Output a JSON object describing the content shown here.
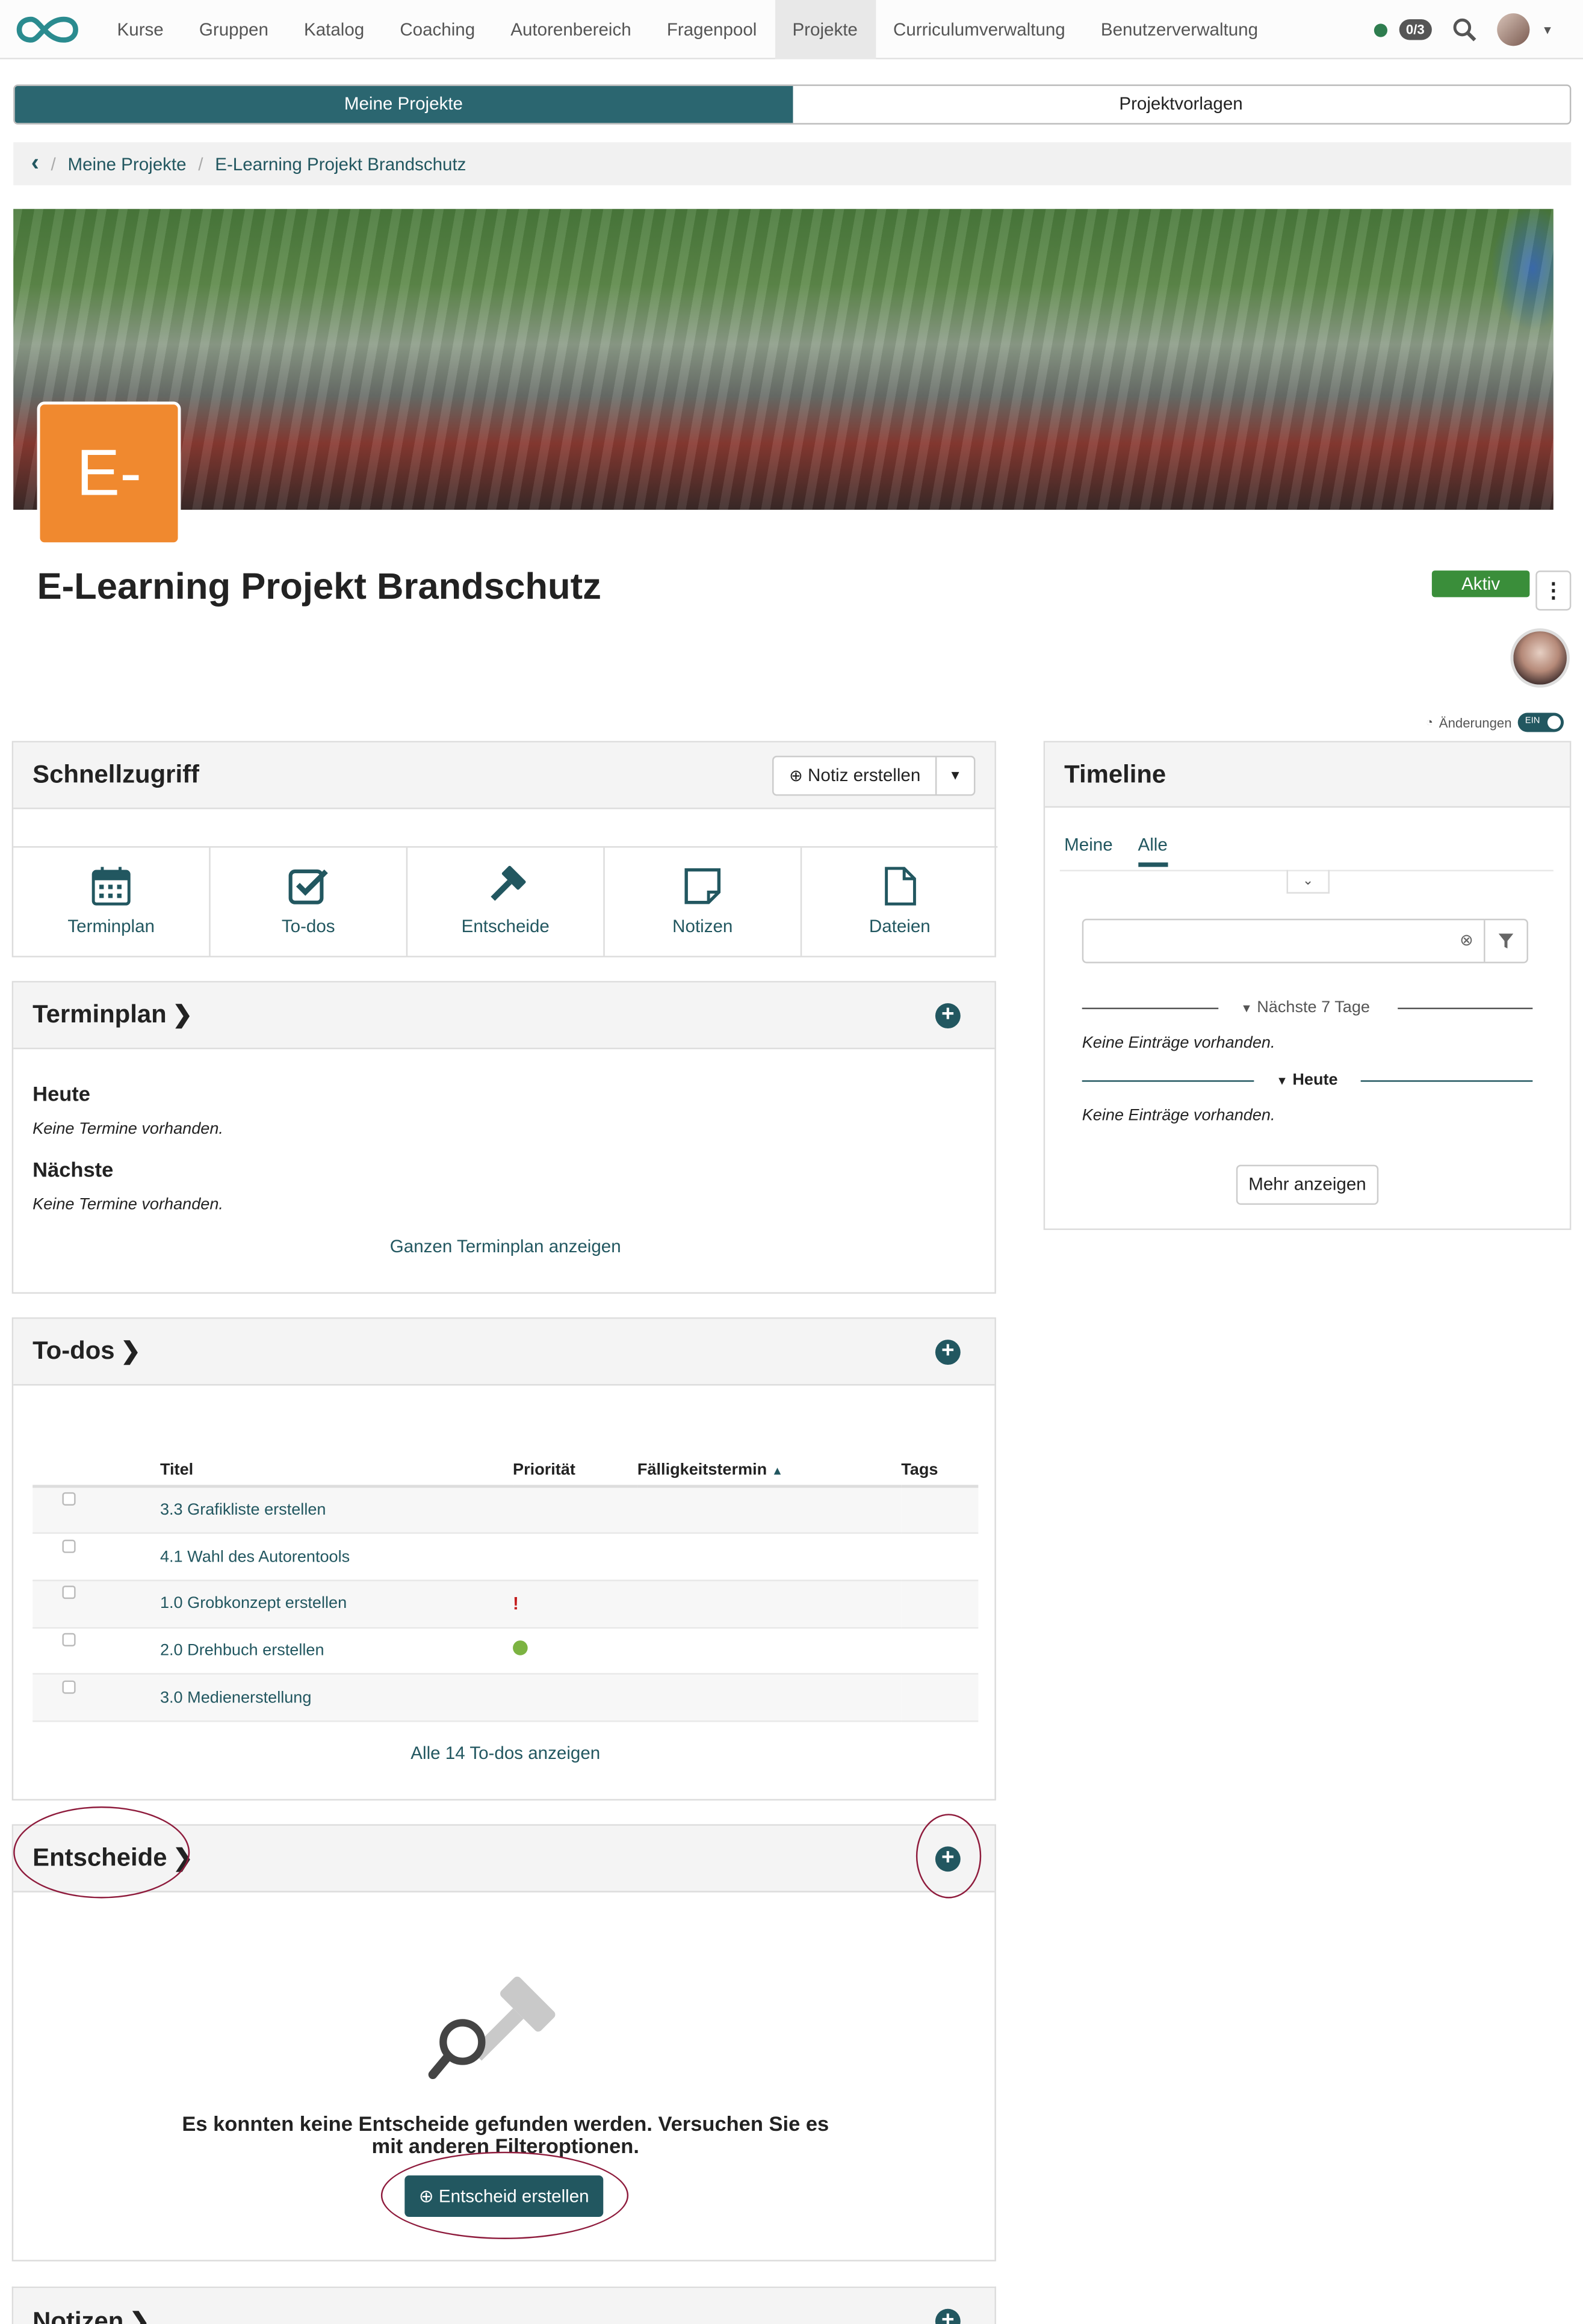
{
  "nav": {
    "items": [
      "Kurse",
      "Gruppen",
      "Katalog",
      "Coaching",
      "Autorenbereich",
      "Fragenpool",
      "Projekte",
      "Curriculumverwaltung",
      "Benutzerverwaltung"
    ],
    "active": "Projekte",
    "badge": "0/3"
  },
  "segments": {
    "mine": "Meine Projekte",
    "templates": "Projektvorlagen"
  },
  "breadcrumb": {
    "back": "‹",
    "sep": "/",
    "root": "Meine Projekte",
    "current": "E-Learning Projekt Brandschutz"
  },
  "project": {
    "logo_text": "E-",
    "title": "E-Learning Projekt Brandschutz",
    "status": "Aktiv",
    "changes_label": "Änderungen",
    "toggle_label": "EIN"
  },
  "quick": {
    "title": "Schnellzugriff",
    "create_note": "Notiz erstellen",
    "items": [
      "Terminplan",
      "To-dos",
      "Entscheide",
      "Notizen",
      "Dateien"
    ]
  },
  "terminplan": {
    "title": "Terminplan",
    "today": "Heute",
    "today_empty": "Keine Termine vorhanden.",
    "next": "Nächste",
    "next_empty": "Keine Termine vorhanden.",
    "show_all": "Ganzen Terminplan anzeigen"
  },
  "todos": {
    "title": "To-dos",
    "headers": [
      "Titel",
      "Priorität",
      "Fälligkeitstermin",
      "Tags"
    ],
    "rows": [
      {
        "title": "3.3 Grafikliste erstellen",
        "priority": ""
      },
      {
        "title": "4.1 Wahl des Autorentools",
        "priority": ""
      },
      {
        "title": "1.0 Grobkonzept erstellen",
        "priority": "!"
      },
      {
        "title": "2.0 Drehbuch erstellen",
        "priority": "dot"
      },
      {
        "title": "3.0 Medienerstellung",
        "priority": ""
      }
    ],
    "show_all": "Alle 14 To-dos anzeigen"
  },
  "entscheide": {
    "title": "Entscheide",
    "empty_line1": "Es konnten keine Entscheide gefunden werden. Versuchen Sie es",
    "empty_line2": "mit anderen Filteroptionen.",
    "create": "Entscheid erstellen"
  },
  "notizen": {
    "title": "Notizen"
  },
  "timeline": {
    "title": "Timeline",
    "tab_mine": "Meine",
    "tab_all": "Alle",
    "next7": "Nächste 7 Tage",
    "next7_empty": "Keine Einträge vorhanden.",
    "today": "Heute",
    "today_empty": "Keine Einträge vorhanden.",
    "more": "Mehr anzeigen"
  },
  "colors": {
    "accent": "#225760",
    "status_green": "#3a8e3a",
    "logo_orange": "#f0892f",
    "highlight_ring": "#8e1b3c"
  }
}
